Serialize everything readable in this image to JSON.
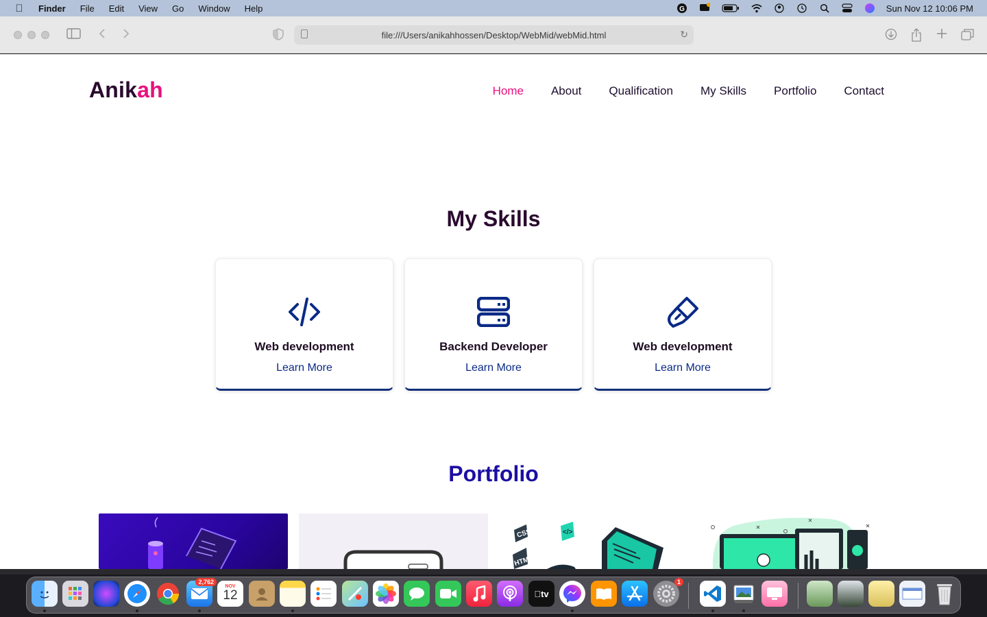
{
  "menubar": {
    "app_name": "Finder",
    "items": [
      "File",
      "Edit",
      "View",
      "Go",
      "Window",
      "Help"
    ],
    "datetime": "Sun Nov 12  10:06 PM"
  },
  "browser": {
    "url": "file:///Users/anikahhossen/Desktop/WebMid/webMid.html"
  },
  "site": {
    "logo_main": "Anik",
    "logo_accent": "ah",
    "nav": [
      "Home",
      "About",
      "Qualification",
      "My Skills",
      "Portfolio",
      "Contact"
    ],
    "skills_title": "My Skills",
    "skills": [
      {
        "title": "Web development",
        "link": "Learn More",
        "icon": "code-icon"
      },
      {
        "title": "Backend Developer",
        "link": "Learn More",
        "icon": "server-icon"
      },
      {
        "title": "Web development",
        "link": "Learn More",
        "icon": "brush-icon"
      }
    ],
    "portfolio_title": "Portfolio"
  },
  "dock": {
    "mail_badge": "2,762",
    "calendar_month": "NOV",
    "calendar_day": "12",
    "settings_badge": "1",
    "apps": [
      "finder",
      "launchpad",
      "siri",
      "safari",
      "chrome",
      "mail",
      "calendar",
      "contacts",
      "notes",
      "reminders",
      "maps",
      "photos",
      "messages",
      "facetime",
      "music",
      "podcasts",
      "tv",
      "messenger",
      "books",
      "app-store",
      "system-settings",
      "vscode",
      "preview",
      "screen-sharing",
      "doc-1",
      "doc-2",
      "doc-3",
      "doc-4",
      "trash"
    ]
  },
  "colors": {
    "accent": "#e8107e",
    "dark": "#2a0a2e",
    "blue": "#0a2a86",
    "portfolio": "#1b0fa3"
  }
}
